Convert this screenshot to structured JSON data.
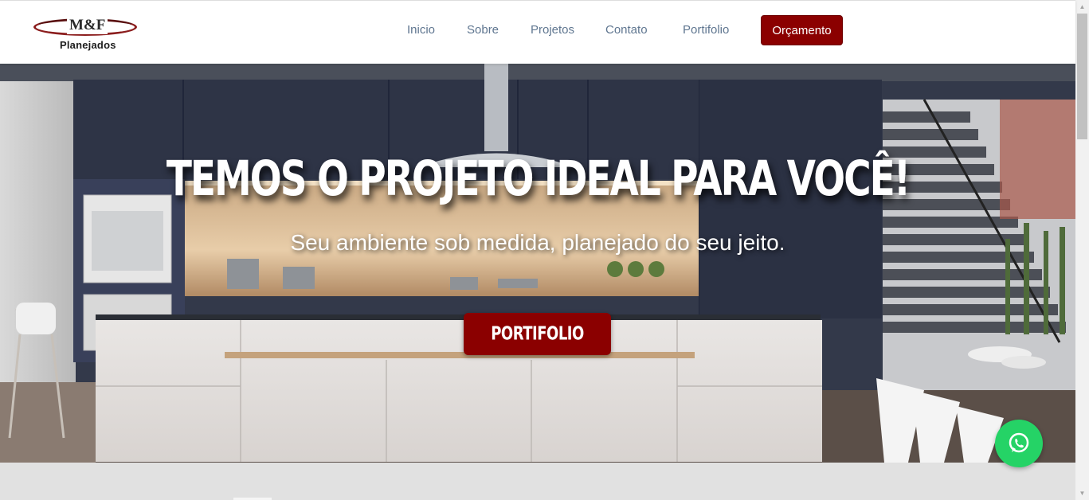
{
  "brand": {
    "mark": "M&F",
    "name": "Planejados"
  },
  "nav": {
    "items": [
      {
        "label": "Inicio"
      },
      {
        "label": "Sobre"
      },
      {
        "label": "Projetos"
      },
      {
        "label": "Contato"
      },
      {
        "label": "Portifolio"
      }
    ],
    "cta_label": "Orçamento"
  },
  "hero": {
    "title": "TEMOS O PROJETO IDEAL PARA VOCÊ!",
    "subtitle": "Seu ambiente sob medida, planejado do seu jeito.",
    "button_label": "PORTIFOLIO"
  },
  "colors": {
    "brand_red": "#8b0000",
    "nav_text": "#5f7690",
    "whatsapp_green": "#25d366"
  },
  "icons": {
    "whatsapp": "whatsapp-icon",
    "scroll_up": "scroll-up-arrow",
    "scroll_down": "scroll-down-arrow"
  }
}
